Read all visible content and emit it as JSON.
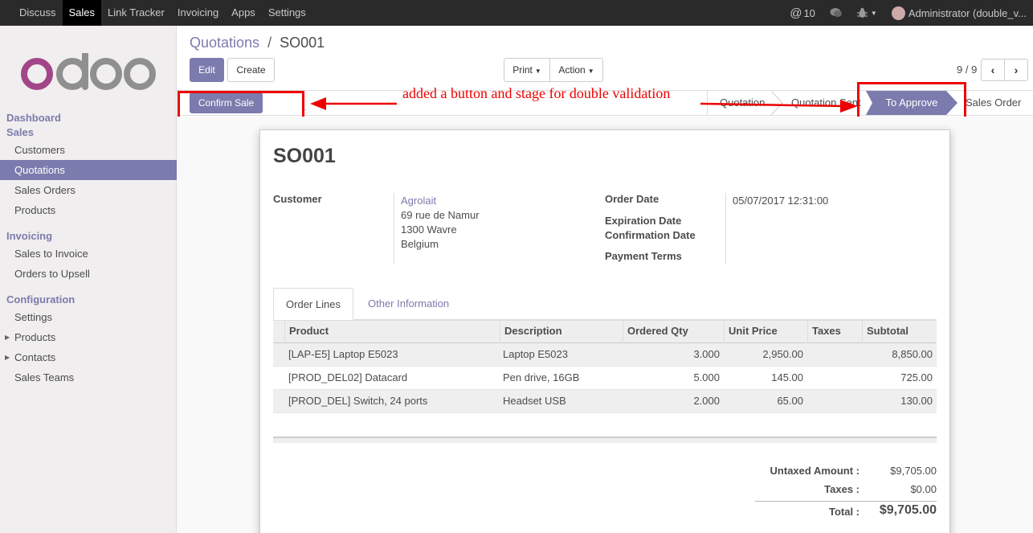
{
  "topbar": {
    "menu": [
      "Discuss",
      "Sales",
      "Link Tracker",
      "Invoicing",
      "Apps",
      "Settings"
    ],
    "active_index": 1,
    "messages_count": "10",
    "user": "Administrator (double_v..."
  },
  "sidebar": {
    "logo_text": "odoo",
    "groups": [
      {
        "header": "Dashboard"
      },
      {
        "header": "Sales",
        "items": [
          "Customers",
          "Quotations",
          "Sales Orders",
          "Products"
        ]
      },
      {
        "header": "Invoicing",
        "items": [
          "Sales to Invoice",
          "Orders to Upsell"
        ]
      },
      {
        "header": "Configuration",
        "items": [
          "Settings",
          "Products",
          "Contacts",
          "Sales Teams"
        ]
      }
    ],
    "active_item": "Quotations"
  },
  "breadcrumb": {
    "parent": "Quotations",
    "separator": "/",
    "current": "SO001"
  },
  "buttons": {
    "edit": "Edit",
    "create": "Create",
    "print": "Print",
    "action": "Action",
    "confirm_sale": "Confirm Sale"
  },
  "pager": {
    "text": "9 / 9"
  },
  "annotation": "added a button and stage for double validation",
  "statusbar": {
    "stages": [
      "Quotation",
      "Quotation Sent",
      "To Approve",
      "Sales Order"
    ],
    "current": "To Approve"
  },
  "record": {
    "name": "SO001",
    "customer_label": "Customer",
    "customer_name": "Agrolait",
    "address": [
      "69 rue de Namur",
      "1300 Wavre",
      "Belgium"
    ],
    "order_date_label": "Order Date",
    "order_date": "05/07/2017 12:31:00",
    "expiration_date_label": "Expiration Date",
    "confirmation_date_label": "Confirmation Date",
    "payment_terms_label": "Payment Terms"
  },
  "tabs": [
    "Order Lines",
    "Other Information"
  ],
  "order_lines": {
    "columns": [
      "Product",
      "Description",
      "Ordered Qty",
      "Unit Price",
      "Taxes",
      "Subtotal"
    ],
    "rows": [
      {
        "product": "[LAP-E5] Laptop E5023",
        "description": "Laptop E5023",
        "qty": "3.000",
        "price": "2,950.00",
        "taxes": "",
        "subtotal": "8,850.00"
      },
      {
        "product": "[PROD_DEL02] Datacard",
        "description": "Pen drive, 16GB",
        "qty": "5.000",
        "price": "145.00",
        "taxes": "",
        "subtotal": "725.00"
      },
      {
        "product": "[PROD_DEL] Switch, 24 ports",
        "description": "Headset USB",
        "qty": "2.000",
        "price": "65.00",
        "taxes": "",
        "subtotal": "130.00"
      }
    ]
  },
  "totals": {
    "untaxed_label": "Untaxed Amount :",
    "untaxed": "$9,705.00",
    "taxes_label": "Taxes :",
    "taxes": "$0.00",
    "total_label": "Total :",
    "total": "$9,705.00"
  },
  "colors": {
    "accent": "#7c7bad",
    "topbar": "#2a2a2a",
    "annotation": "#ee0000"
  }
}
